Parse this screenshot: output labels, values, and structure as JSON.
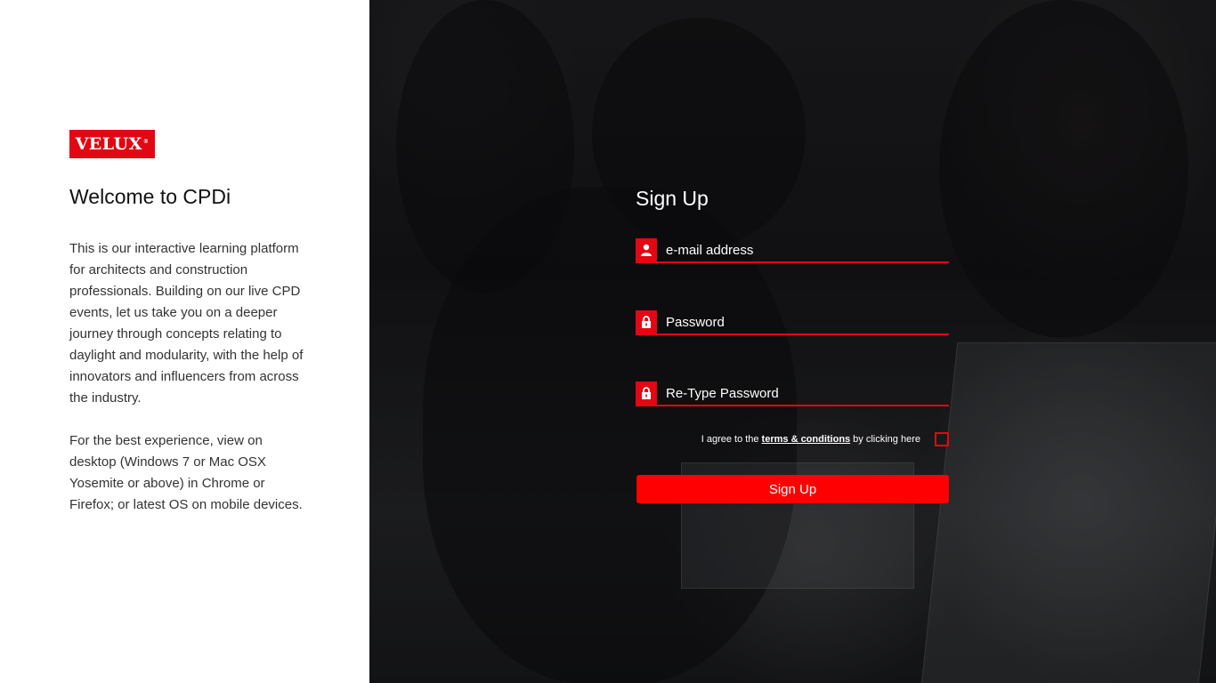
{
  "brand": {
    "logo_text": "VELUX",
    "logo_mark": "®",
    "accent_color": "#e30613"
  },
  "intro": {
    "title": "Welcome to CPDi",
    "description": "This is our interactive learning platform for architects and construction professionals. Building on our live CPD events, let us take you on a deeper journey through concepts relating to daylight and modularity, with the help of innovators and influencers from across the industry.",
    "browser_note": "For the best experience, view on desktop (Windows 7 or Mac OSX Yosemite or above) in Chrome or Firefox; or latest OS on mobile devices."
  },
  "signup": {
    "title": "Sign Up",
    "email": {
      "placeholder": "e-mail address",
      "value": "",
      "icon": "user-icon"
    },
    "password": {
      "placeholder": "Password",
      "value": "",
      "icon": "lock-icon"
    },
    "retype_password": {
      "placeholder": "Re-Type Password",
      "value": "",
      "icon": "lock-icon"
    },
    "agree": {
      "prefix": "I agree to the",
      "link_text": "terms & conditions",
      "suffix": "by clicking here",
      "checked": false
    },
    "button_label": "Sign Up"
  }
}
